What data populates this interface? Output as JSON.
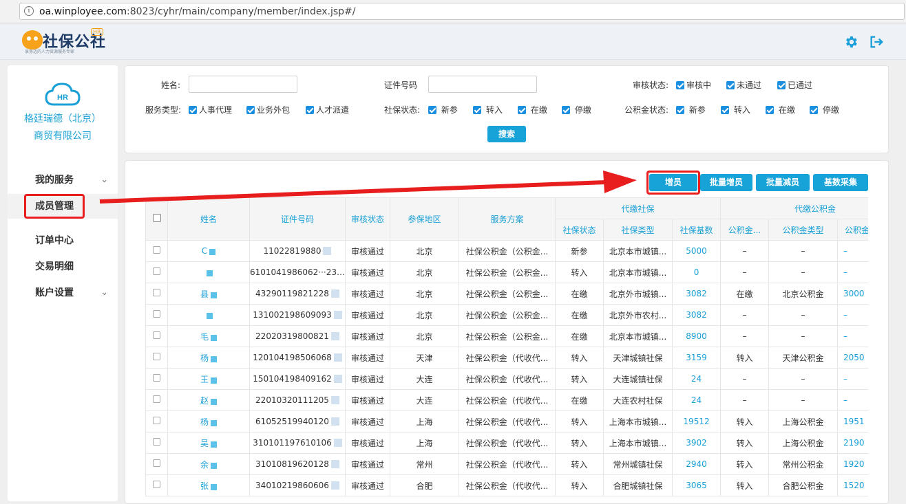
{
  "browser": {
    "url_host": "oa.winployee.com",
    "url_rest": ":8023/cyhr/main/company/member/index.jsp#/"
  },
  "header": {
    "logo_text": "社保公社",
    "logo_badge": "HR",
    "logo_slogan": "享身边的人力资源服务专家"
  },
  "sidebar": {
    "company_logo_text": "HR",
    "company_name": "格廷瑞德（北京）商贸有限公司",
    "items": [
      {
        "label": "我的服务",
        "has_chevron": true
      },
      {
        "label": "成员管理",
        "has_chevron": false
      },
      {
        "label": "订单中心",
        "has_chevron": false
      },
      {
        "label": "交易明细",
        "has_chevron": false
      },
      {
        "label": "账户设置",
        "has_chevron": true
      }
    ]
  },
  "search": {
    "name_label": "姓名:",
    "id_label": "证件号码",
    "audit_label": "审核状态:",
    "audit_options": [
      "审核中",
      "未通过",
      "已通过"
    ],
    "service_label": "服务类型:",
    "service_options": [
      "人事代理",
      "业务外包",
      "人才派遣"
    ],
    "social_label": "社保状态:",
    "social_options": [
      "新参",
      "转入",
      "在缴",
      "停缴"
    ],
    "fund_label": "公积金状态:",
    "fund_options": [
      "新参",
      "转入",
      "在缴",
      "停缴"
    ],
    "search_button": "搜索"
  },
  "toolbar": {
    "add": "增员",
    "batch_add": "批量增员",
    "batch_reduce": "批量减员",
    "base_collect": "基数采集"
  },
  "table": {
    "headers": {
      "name": "姓名",
      "id": "证件号码",
      "audit": "审核状态",
      "region": "参保地区",
      "plan": "服务方案",
      "social_group": "代缴社保",
      "fund_group": "代缴公积金",
      "social_status": "社保状态",
      "social_type": "社保类型",
      "social_base": "社保基数",
      "fund_status": "公积金...",
      "fund_type": "公积金类型",
      "fund_base": "公积金"
    },
    "rows": [
      {
        "name": "C",
        "id": "11022819880",
        "audit": "审核通过",
        "region": "北京",
        "plan": "社保公积金（公积金...",
        "s_status": "新参",
        "s_type": "北京本市城镇...",
        "s_base": "5000",
        "f_status": "–",
        "f_type": "–",
        "f_base": "–"
      },
      {
        "name": "",
        "id": "6101041986062···23",
        "audit": "审核通过",
        "region": "北京",
        "plan": "社保公积金（公积金...",
        "s_status": "转入",
        "s_type": "北京本市城镇...",
        "s_base": "0",
        "f_status": "–",
        "f_type": "–",
        "f_base": "–"
      },
      {
        "name": "县",
        "id": "43290119821228",
        "audit": "审核通过",
        "region": "北京",
        "plan": "社保公积金（公积金...",
        "s_status": "在缴",
        "s_type": "北京外市城镇...",
        "s_base": "3082",
        "f_status": "在缴",
        "f_type": "北京公积金",
        "f_base": "3000"
      },
      {
        "name": "",
        "id": "131002198609093",
        "audit": "审核通过",
        "region": "北京",
        "plan": "社保公积金（公积金...",
        "s_status": "在缴",
        "s_type": "北京外市农村...",
        "s_base": "3082",
        "f_status": "–",
        "f_type": "–",
        "f_base": "–"
      },
      {
        "name": "毛",
        "id": "22020319800821",
        "audit": "审核通过",
        "region": "北京",
        "plan": "社保公积金（公积金...",
        "s_status": "在缴",
        "s_type": "北京本市城镇...",
        "s_base": "8900",
        "f_status": "–",
        "f_type": "–",
        "f_base": "–"
      },
      {
        "name": "杨",
        "id": "120104198506068",
        "audit": "审核通过",
        "region": "天津",
        "plan": "社保公积金（代收代...",
        "s_status": "转入",
        "s_type": "天津城镇社保",
        "s_base": "3159",
        "f_status": "转入",
        "f_type": "天津公积金",
        "f_base": "2050"
      },
      {
        "name": "王",
        "id": "150104198409162",
        "audit": "审核通过",
        "region": "大连",
        "plan": "社保公积金（代收代...",
        "s_status": "转入",
        "s_type": "大连城镇社保",
        "s_base": "24",
        "f_status": "–",
        "f_type": "–",
        "f_base": "–"
      },
      {
        "name": "赵",
        "id": "22010320111205",
        "audit": "审核通过",
        "region": "大连",
        "plan": "社保公积金（代收代...",
        "s_status": "在缴",
        "s_type": "大连农村社保",
        "s_base": "24",
        "f_status": "–",
        "f_type": "–",
        "f_base": "–"
      },
      {
        "name": "杨",
        "id": "61052519940120",
        "audit": "审核通过",
        "region": "上海",
        "plan": "社保公积金（代收代...",
        "s_status": "转入",
        "s_type": "上海本市城镇...",
        "s_base": "19512",
        "f_status": "转入",
        "f_type": "上海公积金",
        "f_base": "1951"
      },
      {
        "name": "吴",
        "id": "310101197610106",
        "audit": "审核通过",
        "region": "上海",
        "plan": "社保公积金（代收代...",
        "s_status": "转入",
        "s_type": "上海本市城镇...",
        "s_base": "3902",
        "f_status": "转入",
        "f_type": "上海公积金",
        "f_base": "2190"
      },
      {
        "name": "余",
        "id": "31010819620128",
        "audit": "审核通过",
        "region": "常州",
        "plan": "社保公积金（代收代...",
        "s_status": "转入",
        "s_type": "常州城镇社保",
        "s_base": "2940",
        "f_status": "转入",
        "f_type": "常州公积金",
        "f_base": "1920"
      },
      {
        "name": "张",
        "id": "34010219860606",
        "audit": "审核通过",
        "region": "合肥",
        "plan": "社保公积金（代收代...",
        "s_status": "转入",
        "s_type": "合肥城镇社保",
        "s_base": "3065",
        "f_status": "转入",
        "f_type": "合肥公积金",
        "f_base": "1520"
      }
    ]
  },
  "colors": {
    "accent": "#18a3d8",
    "annotation_red": "#e81d1d"
  }
}
